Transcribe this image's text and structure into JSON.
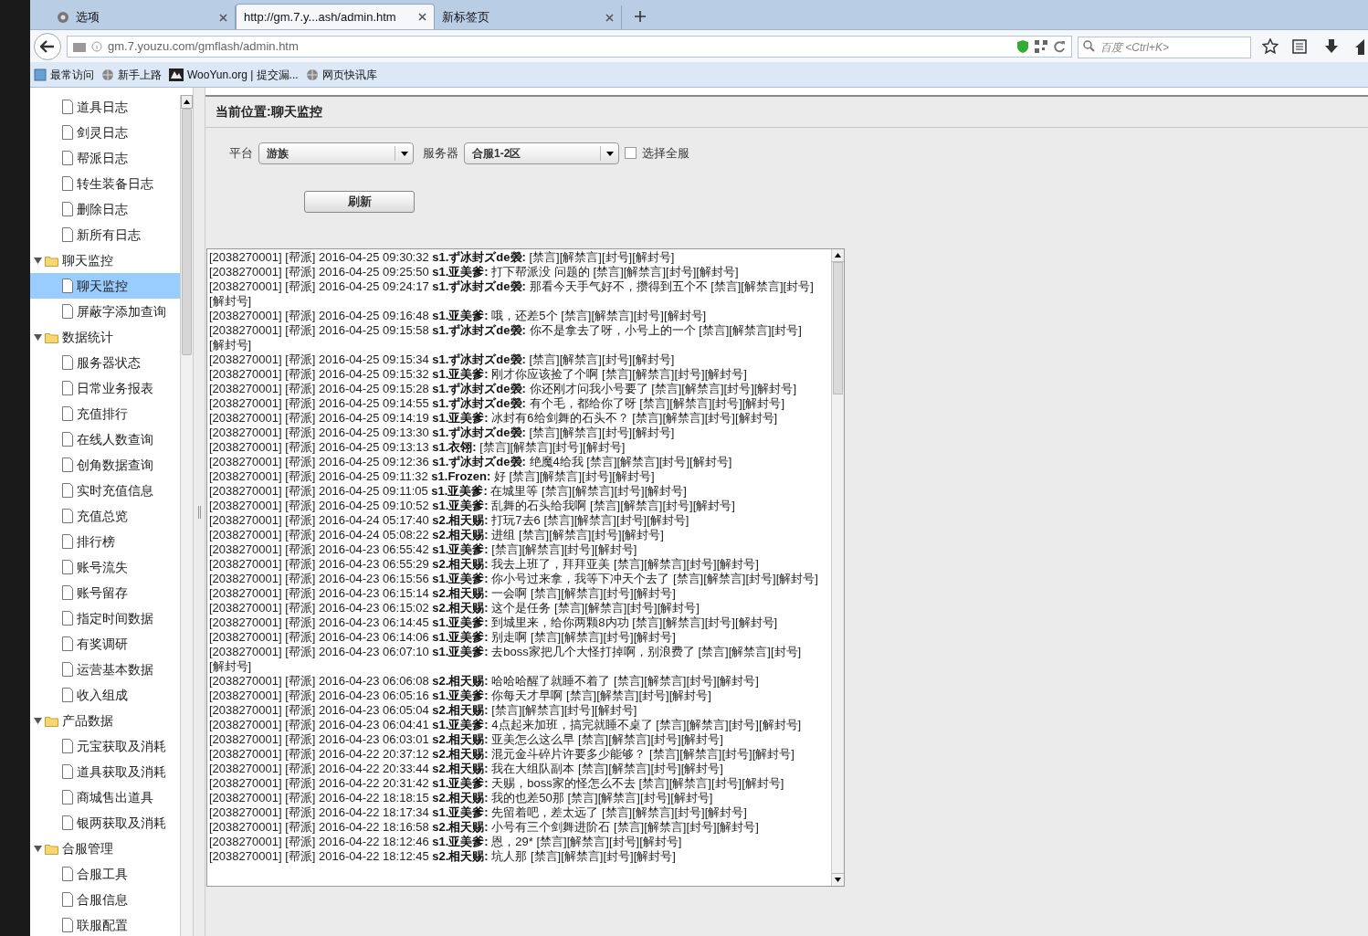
{
  "browser": {
    "tabs": [
      {
        "label": "选项",
        "selected": false,
        "kind": "settings"
      },
      {
        "label": "http://gm.7.y...ash/admin.htm",
        "selected": true,
        "kind": "page"
      },
      {
        "label": "新标签页",
        "selected": false,
        "kind": "page"
      }
    ],
    "url": "gm.7.youzu.com/gmflash/admin.htm",
    "search_placeholder": "百度 <Ctrl+K>",
    "bookmarks": [
      {
        "label": "最常访问",
        "kind": "folder"
      },
      {
        "label": "新手上路",
        "kind": "globe"
      },
      {
        "label": "WooYun.org | 提交漏...",
        "kind": "site"
      },
      {
        "label": "网页快讯库",
        "kind": "globe"
      }
    ]
  },
  "sidebar": {
    "items": [
      {
        "label": "道具日志",
        "kind": "page",
        "selected": false
      },
      {
        "label": "剑灵日志",
        "kind": "page",
        "selected": false
      },
      {
        "label": "帮派日志",
        "kind": "page",
        "selected": false
      },
      {
        "label": "转生装备日志",
        "kind": "page",
        "selected": false
      },
      {
        "label": "删除日志",
        "kind": "page",
        "selected": false
      },
      {
        "label": "新所有日志",
        "kind": "page",
        "selected": false
      },
      {
        "label": "聊天监控",
        "kind": "folder",
        "expanded": true,
        "selected": false,
        "children": [
          {
            "label": "聊天监控",
            "kind": "page",
            "selected": true
          },
          {
            "label": "屏蔽字添加查询",
            "kind": "page",
            "selected": false
          }
        ]
      },
      {
        "label": "数据统计",
        "kind": "folder",
        "expanded": true,
        "selected": false,
        "children": [
          {
            "label": "服务器状态",
            "kind": "page",
            "selected": false
          },
          {
            "label": "日常业务报表",
            "kind": "page",
            "selected": false
          },
          {
            "label": "充值排行",
            "kind": "page",
            "selected": false
          },
          {
            "label": "在线人数查询",
            "kind": "page",
            "selected": false
          },
          {
            "label": "创角数据查询",
            "kind": "page",
            "selected": false
          },
          {
            "label": "实时充值信息",
            "kind": "page",
            "selected": false
          },
          {
            "label": "充值总览",
            "kind": "page",
            "selected": false
          },
          {
            "label": "排行榜",
            "kind": "page",
            "selected": false
          },
          {
            "label": "账号流失",
            "kind": "page",
            "selected": false
          },
          {
            "label": "账号留存",
            "kind": "page",
            "selected": false
          },
          {
            "label": "指定时间数据",
            "kind": "page",
            "selected": false
          },
          {
            "label": "有奖调研",
            "kind": "page",
            "selected": false
          },
          {
            "label": "运营基本数据",
            "kind": "page",
            "selected": false
          },
          {
            "label": "收入组成",
            "kind": "page",
            "selected": false
          }
        ]
      },
      {
        "label": "产品数据",
        "kind": "folder",
        "expanded": true,
        "selected": false,
        "children": [
          {
            "label": "元宝获取及消耗",
            "kind": "page",
            "selected": false
          },
          {
            "label": "道具获取及消耗",
            "kind": "page",
            "selected": false
          },
          {
            "label": "商城售出道具",
            "kind": "page",
            "selected": false
          },
          {
            "label": "银两获取及消耗",
            "kind": "page",
            "selected": false
          }
        ]
      },
      {
        "label": "合服管理",
        "kind": "folder",
        "expanded": true,
        "selected": false,
        "children": [
          {
            "label": "合服工具",
            "kind": "page",
            "selected": false
          },
          {
            "label": "合服信息",
            "kind": "page",
            "selected": false
          },
          {
            "label": "联服配置",
            "kind": "page",
            "selected": false
          }
        ]
      }
    ]
  },
  "main": {
    "breadcrumb": "当前位置:聊天监控",
    "platform": {
      "label": "平台",
      "value": "游族"
    },
    "server": {
      "label": "服务器",
      "value": "合服1-2区"
    },
    "select_all": {
      "label": "选择全服",
      "checked": false
    },
    "refresh_button": "刷新",
    "log": [
      {
        "meta": "[2038270001] [帮派] 2016-04-25 09:30:32",
        "speaker": "s1.ず冰封ズde褮:",
        "actions": [
          "[禁言]",
          "[解禁言]",
          "[封号]",
          "[解封号]"
        ]
      },
      {
        "meta": "[2038270001] [帮派] 2016-04-25 09:25:50",
        "speaker": "s1.亚美爹:",
        "message": "打下帮派没 问题的",
        "actions": [
          "[禁言]",
          "[解禁言]",
          "[封号]",
          "[解封号]"
        ]
      },
      {
        "meta": "[2038270001] [帮派] 2016-04-25 09:24:17",
        "speaker": "s1.ず冰封ズde褮:",
        "message": "那看今天手气好不，攒得到五个不",
        "actions": [
          "[禁言]",
          "[解禁言]",
          "[封号]",
          "[解封号]"
        ]
      },
      {
        "meta": "[2038270001] [帮派] 2016-04-25 09:16:48",
        "speaker": "s1.亚美爹:",
        "message": "哦，还差5个",
        "actions": [
          "[禁言]",
          "[解禁言]",
          "[封号]",
          "[解封号]"
        ]
      },
      {
        "meta": "[2038270001] [帮派] 2016-04-25 09:15:58",
        "speaker": "s1.ず冰封ズde褮:",
        "message": "你不是拿去了呀，小号上的一个",
        "actions": [
          "[禁言]",
          "[解禁言]",
          "[封号]",
          "[解封号]"
        ]
      },
      {
        "meta": "[2038270001] [帮派] 2016-04-25 09:15:34",
        "speaker": "s1.ず冰封ズde褮:",
        "actions": [
          "[禁言]",
          "[解禁言]",
          "[封号]",
          "[解封号]"
        ]
      },
      {
        "meta": "[2038270001] [帮派] 2016-04-25 09:15:32",
        "speaker": "s1.亚美爹:",
        "message": "刚才你应该捡了个啊",
        "actions": [
          "[禁言]",
          "[解禁言]",
          "[封号]",
          "[解封号]"
        ]
      },
      {
        "meta": "[2038270001] [帮派] 2016-04-25 09:15:28",
        "speaker": "s1.ず冰封ズde褮:",
        "message": "你还刚才问我小号要了",
        "actions": [
          "[禁言]",
          "[解禁言]",
          "[封号]",
          "[解封号]"
        ]
      },
      {
        "meta": "[2038270001] [帮派] 2016-04-25 09:14:55",
        "speaker": "s1.ず冰封ズde褮:",
        "message": "有个毛，都给你了呀",
        "actions": [
          "[禁言]",
          "[解禁言]",
          "[封号]",
          "[解封号]"
        ]
      },
      {
        "meta": "[2038270001] [帮派] 2016-04-25 09:14:19",
        "speaker": "s1.亚美爹:",
        "message": "冰封有6给剑舞的石头不？",
        "actions": [
          "[禁言]",
          "[解禁言]",
          "[封号]",
          "[解封号]"
        ]
      },
      {
        "meta": "[2038270001] [帮派] 2016-04-25 09:13:30",
        "speaker": "s1.ず冰封ズde褮:",
        "actions": [
          "[禁言]",
          "[解禁言]",
          "[封号]",
          "[解封号]"
        ]
      },
      {
        "meta": "[2038270001] [帮派] 2016-04-25 09:13:13",
        "speaker": "s1.衣翎:",
        "actions": [
          "[禁言]",
          "[解禁言]",
          "[封号]",
          "[解封号]"
        ]
      },
      {
        "meta": "[2038270001] [帮派] 2016-04-25 09:12:36",
        "speaker": "s1.ず冰封ズde褮:",
        "message": "绝魔4给我",
        "actions": [
          "[禁言]",
          "[解禁言]",
          "[封号]",
          "[解封号]"
        ]
      },
      {
        "meta": "[2038270001] [帮派] 2016-04-25 09:11:32",
        "speaker": "s1.Frozen:",
        "message": "好",
        "actions": [
          "[禁言]",
          "[解禁言]",
          "[封号]",
          "[解封号]"
        ]
      },
      {
        "meta": "[2038270001] [帮派] 2016-04-25 09:11:05",
        "speaker": "s1.亚美爹:",
        "message": "在城里等",
        "actions": [
          "[禁言]",
          "[解禁言]",
          "[封号]",
          "[解封号]"
        ]
      },
      {
        "meta": "[2038270001] [帮派] 2016-04-25 09:10:52",
        "speaker": "s1.亚美爹:",
        "message": "乱舞的石头给我啊",
        "actions": [
          "[禁言]",
          "[解禁言]",
          "[封号]",
          "[解封号]"
        ]
      },
      {
        "meta": "[2038270001] [帮派] 2016-04-24 05:17:40",
        "speaker": "s2.相天赐:",
        "message": "打玩7去6",
        "actions": [
          "[禁言]",
          "[解禁言]",
          "[封号]",
          "[解封号]"
        ]
      },
      {
        "meta": "[2038270001] [帮派] 2016-04-24 05:08:22",
        "speaker": "s2.相天赐:",
        "message": "进组",
        "actions": [
          "[禁言]",
          "[解禁言]",
          "[封号]",
          "[解封号]"
        ]
      },
      {
        "meta": "[2038270001] [帮派] 2016-04-23 06:55:42",
        "speaker": "s1.亚美爹:",
        "actions": [
          "[禁言]",
          "[解禁言]",
          "[封号]",
          "[解封号]"
        ]
      },
      {
        "meta": "[2038270001] [帮派] 2016-04-23 06:55:29",
        "speaker": "s2.相天赐:",
        "message": "我去上班了，拜拜亚美",
        "actions": [
          "[禁言]",
          "[解禁言]",
          "[封号]",
          "[解封号]"
        ]
      },
      {
        "meta": "[2038270001] [帮派] 2016-04-23 06:15:56",
        "speaker": "s1.亚美爹:",
        "message": "你小号过来拿，我等下冲天个去了",
        "actions": [
          "[禁言]",
          "[解禁言]",
          "[封号]",
          "[解封号]"
        ]
      },
      {
        "meta": "[2038270001] [帮派] 2016-04-23 06:15:14",
        "speaker": "s2.相天赐:",
        "message": "一会啊",
        "actions": [
          "[禁言]",
          "[解禁言]",
          "[封号]",
          "[解封号]"
        ]
      },
      {
        "meta": "[2038270001] [帮派] 2016-04-23 06:15:02",
        "speaker": "s2.相天赐:",
        "message": "这个是任务",
        "actions": [
          "[禁言]",
          "[解禁言]",
          "[封号]",
          "[解封号]"
        ]
      },
      {
        "meta": "[2038270001] [帮派] 2016-04-23 06:14:45",
        "speaker": "s1.亚美爹:",
        "message": "到城里来，给你两颗8内功",
        "actions": [
          "[禁言]",
          "[解禁言]",
          "[封号]",
          "[解封号]"
        ]
      },
      {
        "meta": "[2038270001] [帮派] 2016-04-23 06:14:06",
        "speaker": "s1.亚美爹:",
        "message": "别走啊",
        "actions": [
          "[禁言]",
          "[解禁言]",
          "[封号]",
          "[解封号]"
        ]
      },
      {
        "meta": "[2038270001] [帮派] 2016-04-23 06:07:10",
        "speaker": "s1.亚美爹:",
        "message": "去boss家把几个大怪打掉啊，别浪费了",
        "actions": [
          "[禁言]",
          "[解禁言]",
          "[封号]",
          "[解封号]"
        ]
      },
      {
        "meta": "[2038270001] [帮派] 2016-04-23 06:06:08",
        "speaker": "s2.相天赐:",
        "message": "哈哈哈醒了就睡不着了",
        "actions": [
          "[禁言]",
          "[解禁言]",
          "[封号]",
          "[解封号]"
        ]
      },
      {
        "meta": "[2038270001] [帮派] 2016-04-23 06:05:16",
        "speaker": "s1.亚美爹:",
        "message": "你每天才早啊",
        "actions": [
          "[禁言]",
          "[解禁言]",
          "[封号]",
          "[解封号]"
        ]
      },
      {
        "meta": "[2038270001] [帮派] 2016-04-23 06:05:04",
        "speaker": "s2.相天赐:",
        "actions": [
          "[禁言]",
          "[解禁言]",
          "[封号]",
          "[解封号]"
        ]
      },
      {
        "meta": "[2038270001] [帮派] 2016-04-23 06:04:41",
        "speaker": "s1.亚美爹:",
        "message": "4点起来加班，搞完就睡不桌了",
        "actions": [
          "[禁言]",
          "[解禁言]",
          "[封号]",
          "[解封号]"
        ]
      },
      {
        "meta": "[2038270001] [帮派] 2016-04-23 06:03:01",
        "speaker": "s2.相天赐:",
        "message": "亚美怎么这么早",
        "actions": [
          "[禁言]",
          "[解禁言]",
          "[封号]",
          "[解封号]"
        ]
      },
      {
        "meta": "[2038270001] [帮派] 2016-04-22 20:37:12",
        "speaker": "s2.相天赐:",
        "message": "混元金斗碎片许要多少能够？",
        "actions": [
          "[禁言]",
          "[解禁言]",
          "[封号]",
          "[解封号]"
        ]
      },
      {
        "meta": "[2038270001] [帮派] 2016-04-22 20:33:44",
        "speaker": "s2.相天赐:",
        "message": "我在大组队副本",
        "actions": [
          "[禁言]",
          "[解禁言]",
          "[封号]",
          "[解封号]"
        ]
      },
      {
        "meta": "[2038270001] [帮派] 2016-04-22 20:31:42",
        "speaker": "s1.亚美爹:",
        "message": "天赐，boss家的怪怎么不去",
        "actions": [
          "[禁言]",
          "[解禁言]",
          "[封号]",
          "[解封号]"
        ]
      },
      {
        "meta": "[2038270001] [帮派] 2016-04-22 18:18:15",
        "speaker": "s2.相天赐:",
        "message": "我的也差50那",
        "actions": [
          "[禁言]",
          "[解禁言]",
          "[封号]",
          "[解封号]"
        ]
      },
      {
        "meta": "[2038270001] [帮派] 2016-04-22 18:17:34",
        "speaker": "s1.亚美爹:",
        "message": "先留着吧，差太远了",
        "actions": [
          "[禁言]",
          "[解禁言]",
          "[封号]",
          "[解封号]"
        ]
      },
      {
        "meta": "[2038270001] [帮派] 2016-04-22 18:16:58",
        "speaker": "s2.相天赐:",
        "message": "小号有三个剑舞进阶石",
        "actions": [
          "[禁言]",
          "[解禁言]",
          "[封号]",
          "[解封号]"
        ]
      },
      {
        "meta": "[2038270001] [帮派] 2016-04-22 18:12:46",
        "speaker": "s1.亚美爹:",
        "message": "恩，29*",
        "actions": [
          "[禁言]",
          "[解禁言]",
          "[封号]",
          "[解封号]"
        ]
      },
      {
        "meta": "[2038270001] [帮派] 2016-04-22 18:12:45",
        "speaker": "s2.相天赐:",
        "message": "坑人那",
        "actions": [
          "[禁言]",
          "[解禁言]",
          "[封号]",
          "[解封号]"
        ]
      }
    ]
  }
}
